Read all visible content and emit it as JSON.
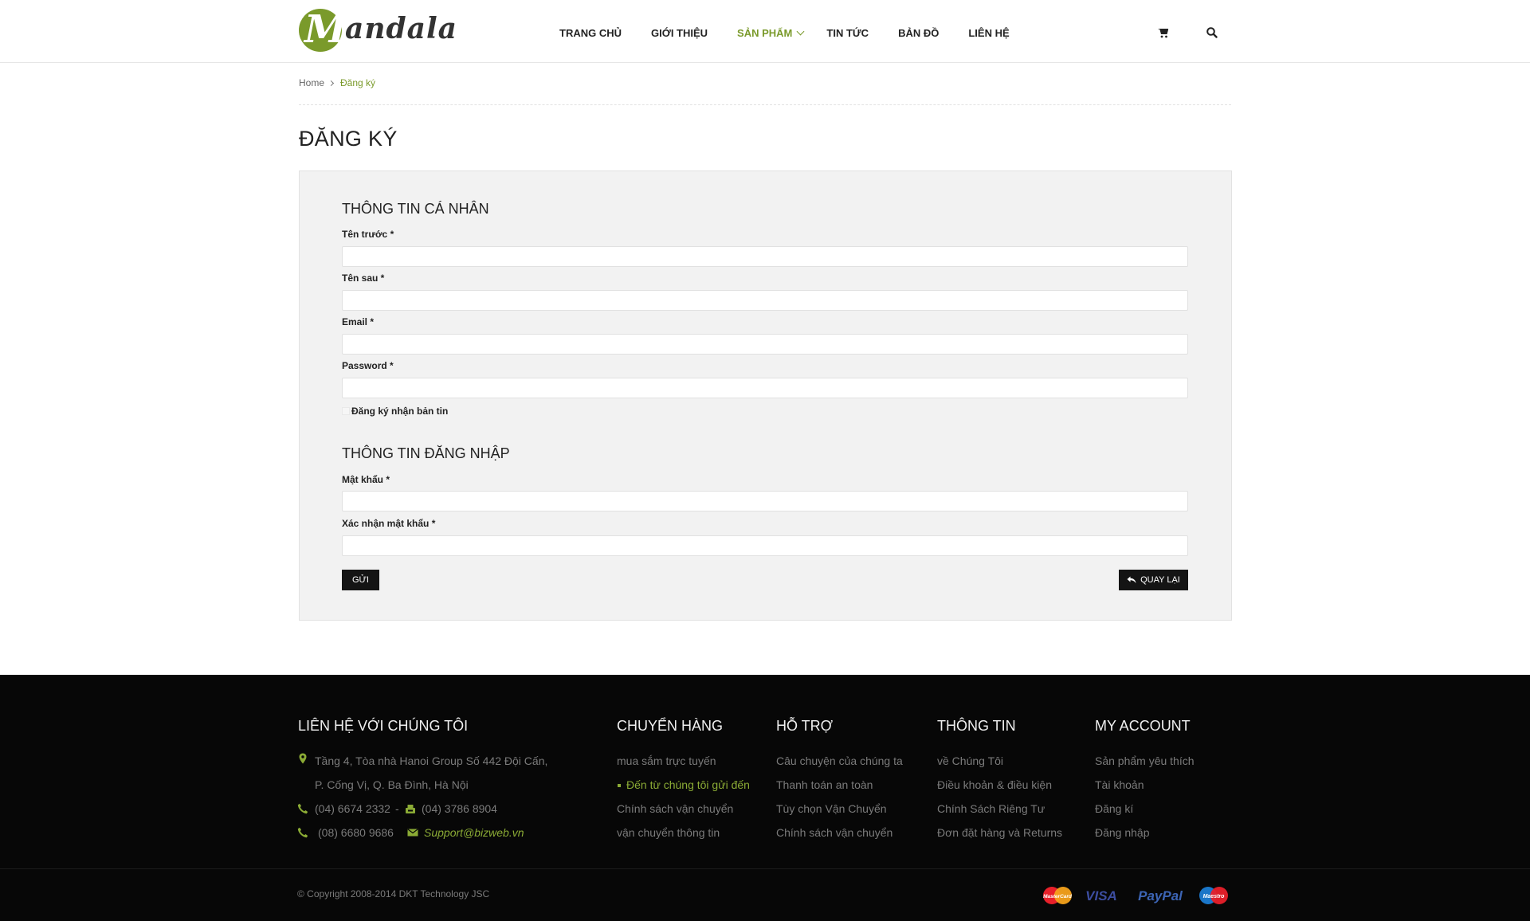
{
  "header": {
    "logo": {
      "letter": "M",
      "text": "andala"
    },
    "nav": [
      {
        "label": "TRANG CHỦ"
      },
      {
        "label": "GIỚI THIỆU"
      },
      {
        "label": "SẢN PHẨM"
      },
      {
        "label": "TIN TỨC"
      },
      {
        "label": "BẢN ĐỒ"
      },
      {
        "label": "LIÊN HỆ"
      }
    ],
    "icons": [
      "cart-icon",
      "search-icon"
    ]
  },
  "breadcrumb": {
    "home": "Home",
    "current": "Đăng ký"
  },
  "page_title": "ĐĂNG KÝ",
  "form": {
    "personal_title": "THÔNG TIN CÁ NHÂN",
    "first_name_label": "Tên trước *",
    "last_name_label": "Tên sau *",
    "email_label": "Email *",
    "password_label": "Password *",
    "newsletter_label": "Đăng ký nhận bản tin",
    "login_title": "THÔNG TIN ĐĂNG NHẬP",
    "login_password_label": "Mật khẩu *",
    "confirm_password_label": "Xác nhận mật khẩu *",
    "submit_label": "GỬI",
    "back_label": "QUAY LẠI"
  },
  "footer": {
    "contact": {
      "title": "LIÊN HỆ VỚI CHÚNG TÔI",
      "address_line1": "Tầng 4, Tòa nhà Hanoi Group  Số 442 Đội Cấn,",
      "address_line2": "P. Cống Vị, Q. Ba Đình, Hà Nội",
      "phone1": "(04) 6674 2332",
      "phone_sep": "-",
      "phone2": "(04) 3786 8904",
      "phone3": "(08) 6680 9686",
      "email": "Support@bizweb.vn"
    },
    "shipping": {
      "title": "CHUYỂN HÀNG",
      "links": [
        "mua sắm trực tuyến",
        "Đến từ chúng tôi gửi đến",
        "Chính sách vận chuyển",
        "vận chuyển thông tin"
      ]
    },
    "support": {
      "title": "HỖ TRỢ",
      "links": [
        "Câu chuyện của chúng ta",
        "Thanh toán an toàn",
        "Tùy chọn Vận Chuyển",
        "Chính sách vận chuyển"
      ]
    },
    "info": {
      "title": "THÔNG TIN",
      "links": [
        "về Chúng Tôi",
        "Điều khoản & điều kiện",
        "Chính Sách Riêng Tư",
        "Đơn đặt hàng và Returns"
      ]
    },
    "account": {
      "title": "MY ACCOUNT",
      "links": [
        "Sản phẩm yêu thích",
        "Tài khoản",
        "Đăng kí",
        "Đăng nhập"
      ]
    },
    "copyright": "© Copyright 2008-2014 DKT Technology JSC",
    "payments": {
      "mastercard": "MasterCard",
      "visa": "VISA",
      "paypal": "PayPal",
      "maestro": "Maestro"
    }
  },
  "colors": {
    "accent": "#7a9a2b",
    "footer_bg": "#070707",
    "panel_bg": "#f2f2f2",
    "button_bg": "#141414"
  }
}
